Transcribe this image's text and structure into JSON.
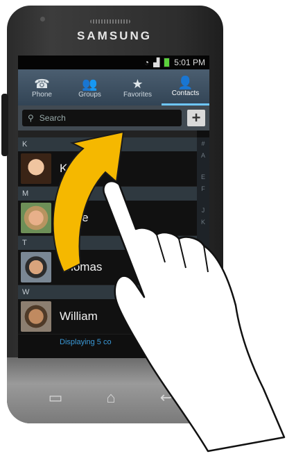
{
  "device": {
    "brand": "SAMSUNG"
  },
  "status_bar": {
    "time": "5:01 PM"
  },
  "tabs": [
    {
      "label": "Phone",
      "icon": "phone-icon"
    },
    {
      "label": "Groups",
      "icon": "groups-icon"
    },
    {
      "label": "Favorites",
      "icon": "star-icon"
    },
    {
      "label": "Contacts",
      "icon": "person-icon",
      "active": true
    }
  ],
  "search": {
    "placeholder": "Search",
    "add_label": "+"
  },
  "sections": [
    {
      "header": "K",
      "contacts": [
        {
          "name": "K"
        }
      ]
    },
    {
      "header": "M",
      "contacts": [
        {
          "name": "aggie"
        }
      ]
    },
    {
      "header": "T",
      "contacts": [
        {
          "name": "Thomas"
        }
      ]
    },
    {
      "header": "W",
      "contacts": [
        {
          "name": "William"
        }
      ]
    }
  ],
  "footer": {
    "text": "Displaying 5 co"
  },
  "index_bar": {
    "letters": [
      "#",
      "A",
      "",
      "",
      "E",
      "F",
      "",
      "",
      "J",
      "K"
    ]
  },
  "colors": {
    "accent": "#6ec6ff",
    "arrow": "#f5b800",
    "footer_text": "#3b9ad9"
  }
}
